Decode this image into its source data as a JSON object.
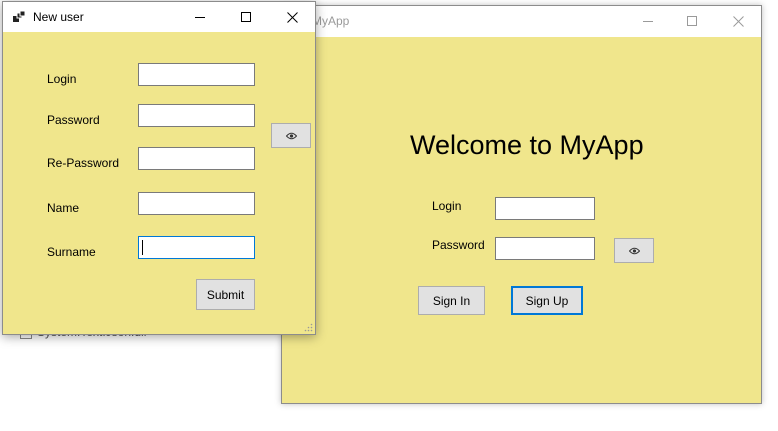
{
  "background": {
    "partial_text": "System.Text.Json.dll"
  },
  "main_window": {
    "title": "MyApp",
    "welcome": "Welcome to MyApp",
    "login_label": "Login",
    "password_label": "Password",
    "login_value": "",
    "password_value": "",
    "sign_in": "Sign In",
    "sign_up": "Sign Up",
    "show_password_icon": "eye-icon"
  },
  "dialog": {
    "title": "New user",
    "fields": {
      "login": "Login",
      "password": "Password",
      "re_password": "Re-Password",
      "name": "Name",
      "surname": "Surname"
    },
    "values": {
      "login": "",
      "password": "",
      "re_password": "",
      "name": "",
      "surname": ""
    },
    "submit": "Submit",
    "show_password_icon": "eye-icon"
  },
  "colors": {
    "form_background": "#f0e68c",
    "accent": "#0078d7",
    "button": "#e1e1e1"
  }
}
